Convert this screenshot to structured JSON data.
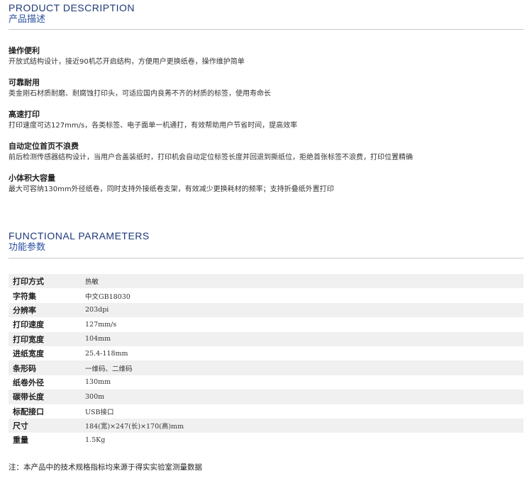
{
  "product_description": {
    "title_en": "PRODUCT DESCRIPTION",
    "title_cn": "产品描述",
    "features": [
      {
        "title": "操作便利",
        "desc": "开放式结构设计，接近90机芯开启结构，方便用户更换纸卷，操作维护简单"
      },
      {
        "title": "可靠耐用",
        "desc": "类金刚石材质耐磨、耐腐蚀打印头，可适应国内良莠不齐的材质的标签，使用寿命长"
      },
      {
        "title": "高速打印",
        "desc": "打印速度可达127mm/s，各类标签、电子面单一机通打，有效帮助用户节省时间，提高效率"
      },
      {
        "title": "自动定位首页不浪费",
        "desc": "前后检测传感器结构设计，当用户合盖装纸时，打印机会自动定位标签长度并回退到撕纸位，拒绝首张标签不浪费，打印位置精确"
      },
      {
        "title": "小体积大容量",
        "desc": "最大可容纳130mm外径纸卷，同时支持外接纸卷支架，有效减少更换耗材的频率；支持折叠纸外置打印"
      }
    ]
  },
  "functional_parameters": {
    "title_en": "FUNCTIONAL PARAMETERS",
    "title_cn": "功能参数",
    "rows": [
      {
        "label": "打印方式",
        "value": "热敏"
      },
      {
        "label": "字符集",
        "value": "中文GB18030"
      },
      {
        "label": "分辨率",
        "value": "203dpi"
      },
      {
        "label": "打印速度",
        "value": "127mm/s"
      },
      {
        "label": "打印宽度",
        "value": "104mm"
      },
      {
        "label": "进纸宽度",
        "value": "25.4-118mm"
      },
      {
        "label": "条形码",
        "value": "一维码、二维码"
      },
      {
        "label": "纸卷外径",
        "value": "130mm"
      },
      {
        "label": "碳带长度",
        "value": "300m"
      },
      {
        "label": "标配接口",
        "value": "USB接口"
      },
      {
        "label": "尺寸",
        "value": "184(宽)×247(长)×170(高)mm"
      },
      {
        "label": "重量",
        "value": "1.5Kg"
      }
    ]
  },
  "note": "注：本产品中的技术规格指标均来源于得实实验室测量数据"
}
